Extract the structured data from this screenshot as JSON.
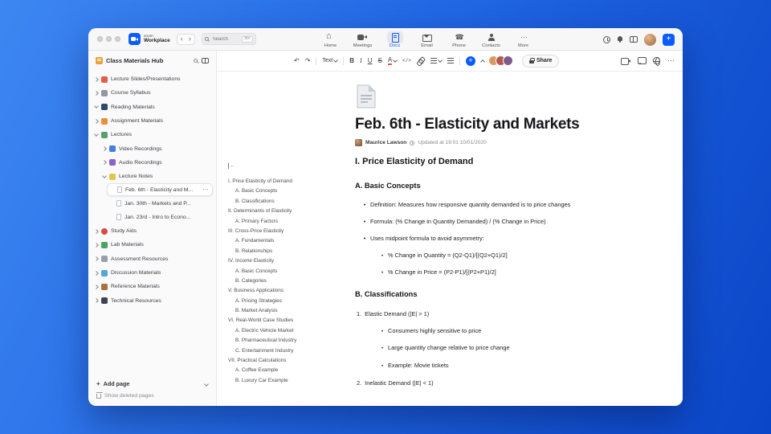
{
  "accent": {
    "blue": "#0b5cff"
  },
  "topbar": {
    "logo_top": "zoom",
    "logo_bottom": "Workplace",
    "search": {
      "placeholder": "Search",
      "shortcut": "⌘F"
    },
    "tabs": [
      {
        "label": "Home",
        "icon": "home"
      },
      {
        "label": "Meetings",
        "icon": "camera"
      },
      {
        "label": "Docs",
        "icon": "doc",
        "active": true
      },
      {
        "label": "Email",
        "icon": "mail"
      },
      {
        "label": "Phone",
        "icon": "phone"
      },
      {
        "label": "Contacts",
        "icon": "contacts"
      },
      {
        "label": "More",
        "icon": "more"
      }
    ]
  },
  "sidebar": {
    "title": "Class Materials Hub",
    "tree": [
      {
        "label": "Lecture Slides/Presentations",
        "level": 0,
        "chevron": "right",
        "icon": "slides"
      },
      {
        "label": "Course Syllabus",
        "level": 0,
        "chevron": "right",
        "icon": "syllabus"
      },
      {
        "label": "Reading Materials",
        "level": 0,
        "chevron": "down",
        "icon": "book"
      },
      {
        "label": "Assignment Materials",
        "level": 0,
        "chevron": "right",
        "icon": "assignment"
      },
      {
        "label": "Lectures",
        "level": 0,
        "chevron": "down",
        "icon": "lectures"
      },
      {
        "label": "Video Recordings",
        "level": 1,
        "chevron": "right",
        "icon": "video"
      },
      {
        "label": "Audio Recordings",
        "level": 1,
        "chevron": "right",
        "icon": "audio"
      },
      {
        "label": "Lecture Notes",
        "level": 1,
        "chevron": "down",
        "icon": "notes"
      },
      {
        "label": "Feb. 6th - Elasticity and M...",
        "level": 2,
        "icon": "page",
        "selected": true
      },
      {
        "label": "Jan. 30th - Markets and P...",
        "level": 2,
        "icon": "page"
      },
      {
        "label": "Jan. 23rd - Intro to Econo...",
        "level": 2,
        "icon": "page"
      },
      {
        "label": "Study Aids",
        "level": 0,
        "chevron": "right",
        "icon": "apple"
      },
      {
        "label": "Lab Materials",
        "level": 0,
        "chevron": "right",
        "icon": "lab"
      },
      {
        "label": "Assessment Resources",
        "level": 0,
        "chevron": "right",
        "icon": "assessment"
      },
      {
        "label": "Discussion Materials",
        "level": 0,
        "chevron": "right",
        "icon": "discussion"
      },
      {
        "label": "Reference Materials",
        "level": 0,
        "chevron": "right",
        "icon": "reference"
      },
      {
        "label": "Technical Resources",
        "level": 0,
        "chevron": "right",
        "icon": "technical"
      }
    ],
    "add_page": "Add page",
    "show_deleted": "Show deleted pages"
  },
  "toolbar": {
    "text_style": "Text",
    "share_label": "Share",
    "avatars": [
      {
        "color": "#d99a62"
      },
      {
        "color": "#b4584e"
      },
      {
        "color": "#7d5a8c"
      }
    ]
  },
  "outline": {
    "items": [
      {
        "label": "I. Price Elasticity of Demand",
        "level": 0
      },
      {
        "label": "A. Basic Concepts",
        "level": 1
      },
      {
        "label": "B. Classifications",
        "level": 1
      },
      {
        "label": "II. Determinants of Elasticity",
        "level": 0
      },
      {
        "label": "A. Primary Factors",
        "level": 1
      },
      {
        "label": "III. Cross-Price Elasticity",
        "level": 0
      },
      {
        "label": "A. Fundamentals",
        "level": 1
      },
      {
        "label": "B. Relationships",
        "level": 1
      },
      {
        "label": "IV. Income Elasticity",
        "level": 0
      },
      {
        "label": "A. Basic Concepts",
        "level": 1
      },
      {
        "label": "B. Categories",
        "level": 1
      },
      {
        "label": "V. Business Applications",
        "level": 0
      },
      {
        "label": "A. Pricing Strategies",
        "level": 1
      },
      {
        "label": "B. Market Analysis",
        "level": 1
      },
      {
        "label": "VI. Real-World Case Studies",
        "level": 0
      },
      {
        "label": "A. Electric Vehicle Market",
        "level": 1
      },
      {
        "label": "B. Pharmaceutical Industry",
        "level": 1
      },
      {
        "label": "C. Entertainment Industry",
        "level": 1
      },
      {
        "label": "VII. Practical Calculations",
        "level": 0
      },
      {
        "label": "A. Coffee Example",
        "level": 1
      },
      {
        "label": "B. Luxury Car Example",
        "level": 1
      }
    ]
  },
  "doc": {
    "title": "Feb. 6th - Elasticity and Markets",
    "author": "Maurice Lawson",
    "updated": "Updated at 19:01 10/01/2020",
    "blocks": [
      {
        "type": "h2",
        "text": "I. Price Elasticity of Demand"
      },
      {
        "type": "h3",
        "text": "A. Basic Concepts"
      },
      {
        "type": "bullet",
        "level": 1,
        "text": "Definition: Measures how responsive quantity demanded is to price changes"
      },
      {
        "type": "bullet",
        "level": 1,
        "text": "Formula: (% Change in Quantity Demanded) / (% Change in Price)"
      },
      {
        "type": "bullet",
        "level": 1,
        "text": "Uses midpoint formula to avoid asymmetry:"
      },
      {
        "type": "bullet",
        "level": 2,
        "text": "% Change in Quantity = (Q2-Q1)/[(Q2+Q1)/2]"
      },
      {
        "type": "bullet",
        "level": 2,
        "text": "% Change in Price = (P2-P1)/[(P2+P1)/2]"
      },
      {
        "type": "h3",
        "text": "B. Classifications"
      },
      {
        "type": "number",
        "num": "1.",
        "text": "Elastic Demand (|E| > 1)"
      },
      {
        "type": "bullet",
        "level": 2,
        "text": "Consumers highly sensitive to price"
      },
      {
        "type": "bullet",
        "level": 2,
        "text": "Large quantity change relative to price change"
      },
      {
        "type": "bullet",
        "level": 2,
        "text": "Example: Movie tickets"
      },
      {
        "type": "number",
        "num": "2.",
        "text": "Inelastic Demand (|E| < 1)"
      }
    ]
  }
}
